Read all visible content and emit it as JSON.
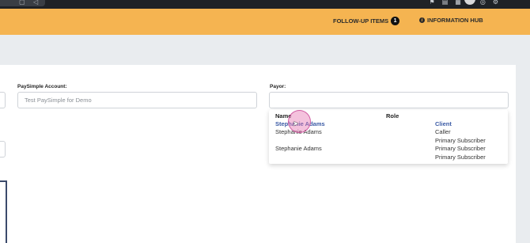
{
  "header": {
    "follow_up_label": "FOLLOW-UP ITEMS",
    "follow_up_count": "1",
    "info_hub_label": "INFORMATION HUB",
    "info_icon": "i"
  },
  "form": {
    "paysimple_label": "PaySimple Account:",
    "paysimple_value": "Test PaySimple for Demo",
    "payor_label": "Payor:",
    "payor_value": ""
  },
  "payor_dropdown": {
    "headers": {
      "name": "Name",
      "role": "Role"
    },
    "names": [
      "Stephanie Adams",
      "Stephanie Adams",
      "Stephanie Adams"
    ],
    "roles": [
      "Client",
      "Caller",
      "Primary Subscriber",
      "Primary Subscriber",
      "Primary Subscriber"
    ]
  },
  "colors": {
    "accent": "#f5b451",
    "link": "#3a5aa5",
    "topbar": "#1f2226"
  }
}
